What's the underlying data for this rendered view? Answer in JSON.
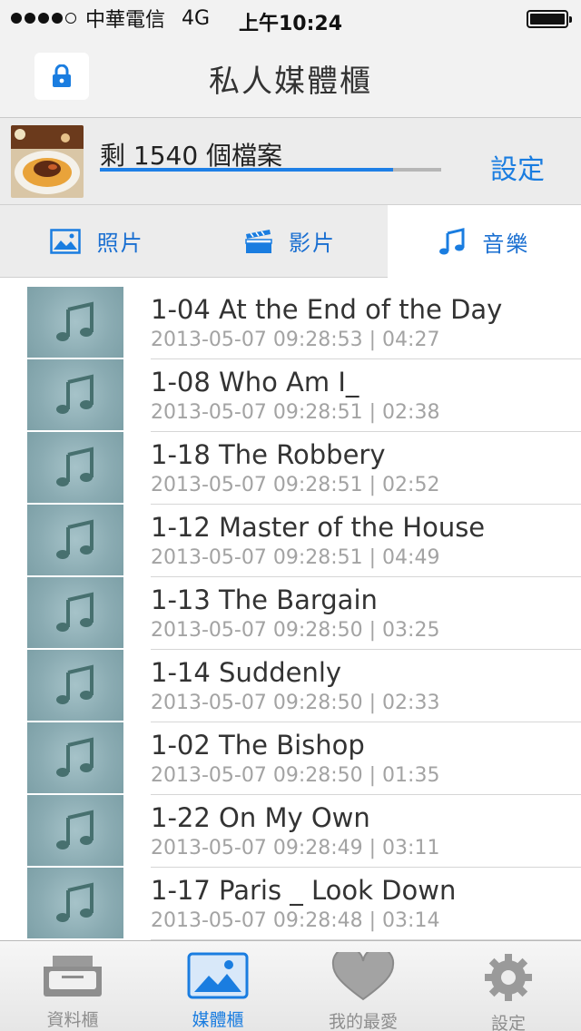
{
  "status_bar": {
    "carrier": "中華電信",
    "network": "4G",
    "time": "上午10:24"
  },
  "nav": {
    "title": "私人媒體櫃",
    "lock_icon": "lock-icon"
  },
  "quota": {
    "text": "剩 1540 個檔案",
    "progress": 0.86,
    "settings_label": "設定"
  },
  "tabs": [
    {
      "label": "照片",
      "icon": "photo-icon"
    },
    {
      "label": "影片",
      "icon": "clapperboard-icon"
    },
    {
      "label": "音樂",
      "icon": "music-note-icon",
      "active": true
    }
  ],
  "tracks": [
    {
      "title": "1-04 At the End of the Day",
      "meta": "2013-05-07 09:28:53 | 04:27"
    },
    {
      "title": "1-08 Who Am I_",
      "meta": "2013-05-07 09:28:51 | 02:38"
    },
    {
      "title": "1-18 The Robbery",
      "meta": "2013-05-07 09:28:51 | 02:52"
    },
    {
      "title": "1-12 Master of the House",
      "meta": "2013-05-07 09:28:51 | 04:49"
    },
    {
      "title": "1-13 The Bargain",
      "meta": "2013-05-07 09:28:50 | 03:25"
    },
    {
      "title": "1-14 Suddenly",
      "meta": "2013-05-07 09:28:50 | 02:33"
    },
    {
      "title": "1-02 The Bishop",
      "meta": "2013-05-07 09:28:50 | 01:35"
    },
    {
      "title": "1-22 On My Own",
      "meta": "2013-05-07 09:28:49 | 03:11"
    },
    {
      "title": "1-17 Paris _ Look Down",
      "meta": "2013-05-07 09:28:48 | 03:14"
    }
  ],
  "tab_bar": [
    {
      "label": "資料櫃",
      "icon": "cabinet-icon"
    },
    {
      "label": "媒體櫃",
      "icon": "media-icon",
      "active": true
    },
    {
      "label": "我的最愛",
      "icon": "heart-icon"
    },
    {
      "label": "設定",
      "icon": "gear-icon"
    }
  ],
  "colors": {
    "accent": "#1a7de0",
    "thumb": "#8aabb2"
  }
}
